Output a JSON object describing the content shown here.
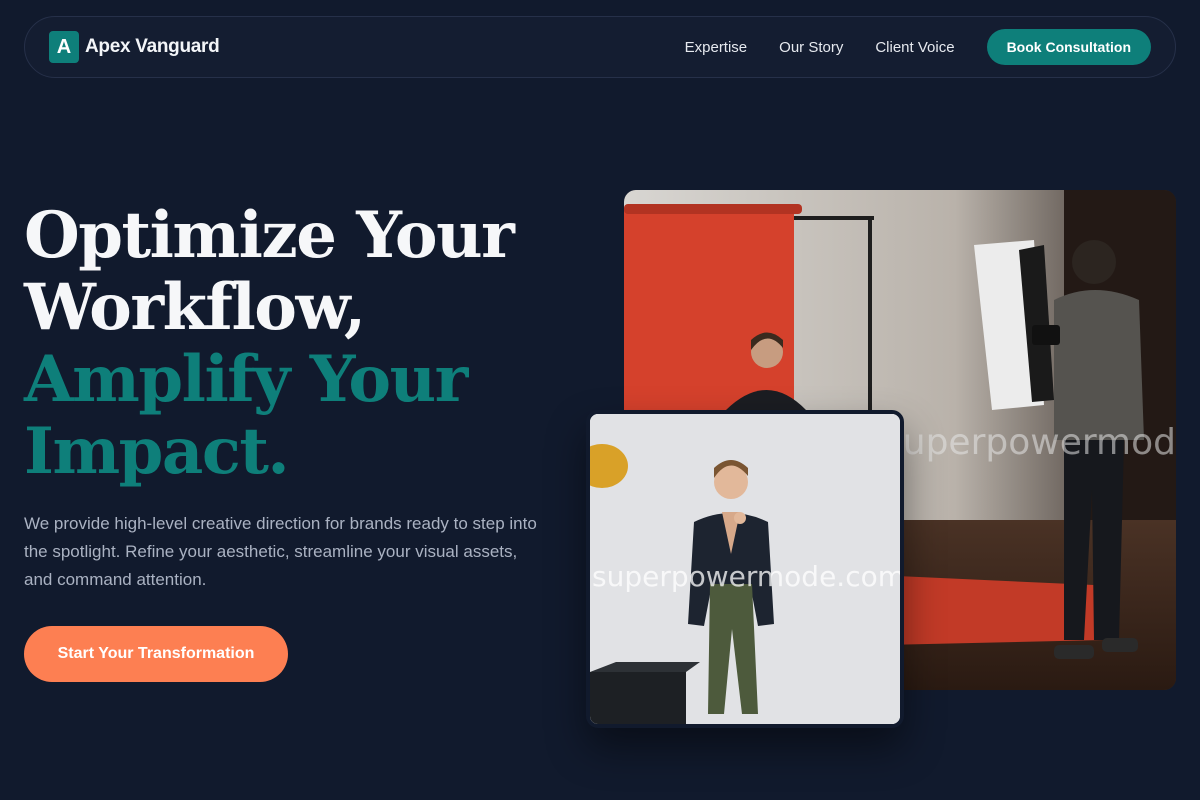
{
  "brand": {
    "mark": "A",
    "name": "Apex Vanguard",
    "accent_color": "#0e7f7a"
  },
  "nav": {
    "links": [
      {
        "label": "Expertise"
      },
      {
        "label": "Our Story"
      },
      {
        "label": "Client Voice"
      }
    ],
    "cta_label": "Book Consultation"
  },
  "hero": {
    "title_lines": [
      "Optimize Your",
      "Workflow,"
    ],
    "accent_lines": [
      "Amplify Your",
      "Impact."
    ],
    "description": "We provide high-level creative direction for brands ready to step into the spotlight. Refine your aesthetic, streamline your visual assets, and command attention.",
    "cta_label": "Start Your Transformation",
    "cta_color": "#fd7f52"
  },
  "photos": {
    "large": {
      "subject": "photographer shooting a model against a red backdrop in a studio",
      "watermark": "superpowermode.com"
    },
    "small": {
      "subject": "young man in dark blazer and olive trousers posing against white wall",
      "watermark": "superpowermode.com"
    }
  },
  "colors": {
    "background": "#111a2d",
    "text": "#f3f5f8",
    "muted_text": "#aab2c2"
  }
}
